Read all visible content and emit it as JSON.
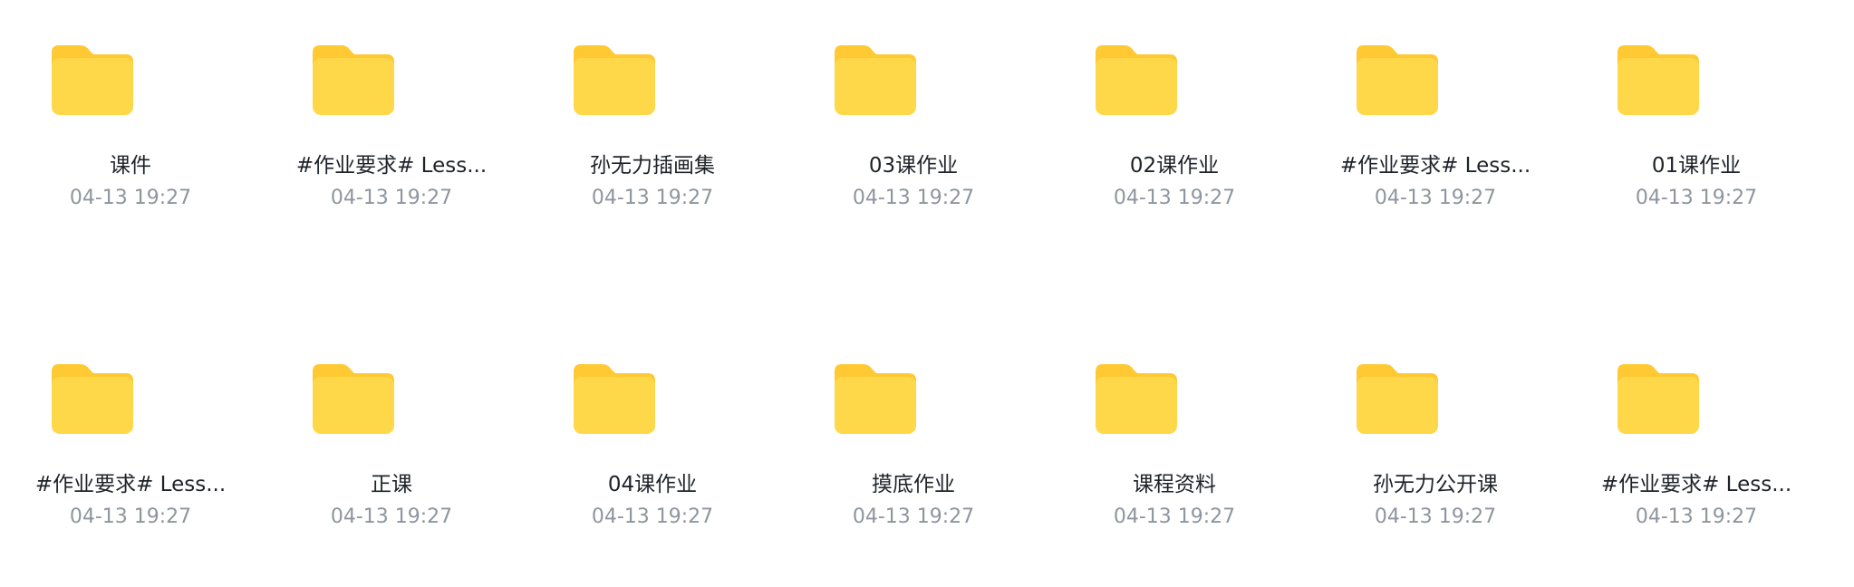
{
  "colors": {
    "folder_back": "#FFC933",
    "folder_front": "#FFD84A",
    "name_text": "#1F2329",
    "time_text": "#8F959E"
  },
  "folders": [
    {
      "name": "课件",
      "time": "04-13 19:27",
      "icon": "folder-icon"
    },
    {
      "name": "#作业要求# Less...",
      "time": "04-13 19:27",
      "icon": "folder-icon"
    },
    {
      "name": "孙无力插画集",
      "time": "04-13 19:27",
      "icon": "folder-icon"
    },
    {
      "name": "03课作业",
      "time": "04-13 19:27",
      "icon": "folder-icon"
    },
    {
      "name": "02课作业",
      "time": "04-13 19:27",
      "icon": "folder-icon"
    },
    {
      "name": "#作业要求# Less...",
      "time": "04-13 19:27",
      "icon": "folder-icon"
    },
    {
      "name": "01课作业",
      "time": "04-13 19:27",
      "icon": "folder-icon"
    },
    {
      "name": "#作业要求# Less...",
      "time": "04-13 19:27",
      "icon": "folder-icon"
    },
    {
      "name": "正课",
      "time": "04-13 19:27",
      "icon": "folder-icon"
    },
    {
      "name": "04课作业",
      "time": "04-13 19:27",
      "icon": "folder-icon"
    },
    {
      "name": "摸底作业",
      "time": "04-13 19:27",
      "icon": "folder-icon"
    },
    {
      "name": "课程资料",
      "time": "04-13 19:27",
      "icon": "folder-icon"
    },
    {
      "name": "孙无力公开课",
      "time": "04-13 19:27",
      "icon": "folder-icon"
    },
    {
      "name": "#作业要求# Less...",
      "time": "04-13 19:27",
      "icon": "folder-icon"
    }
  ]
}
